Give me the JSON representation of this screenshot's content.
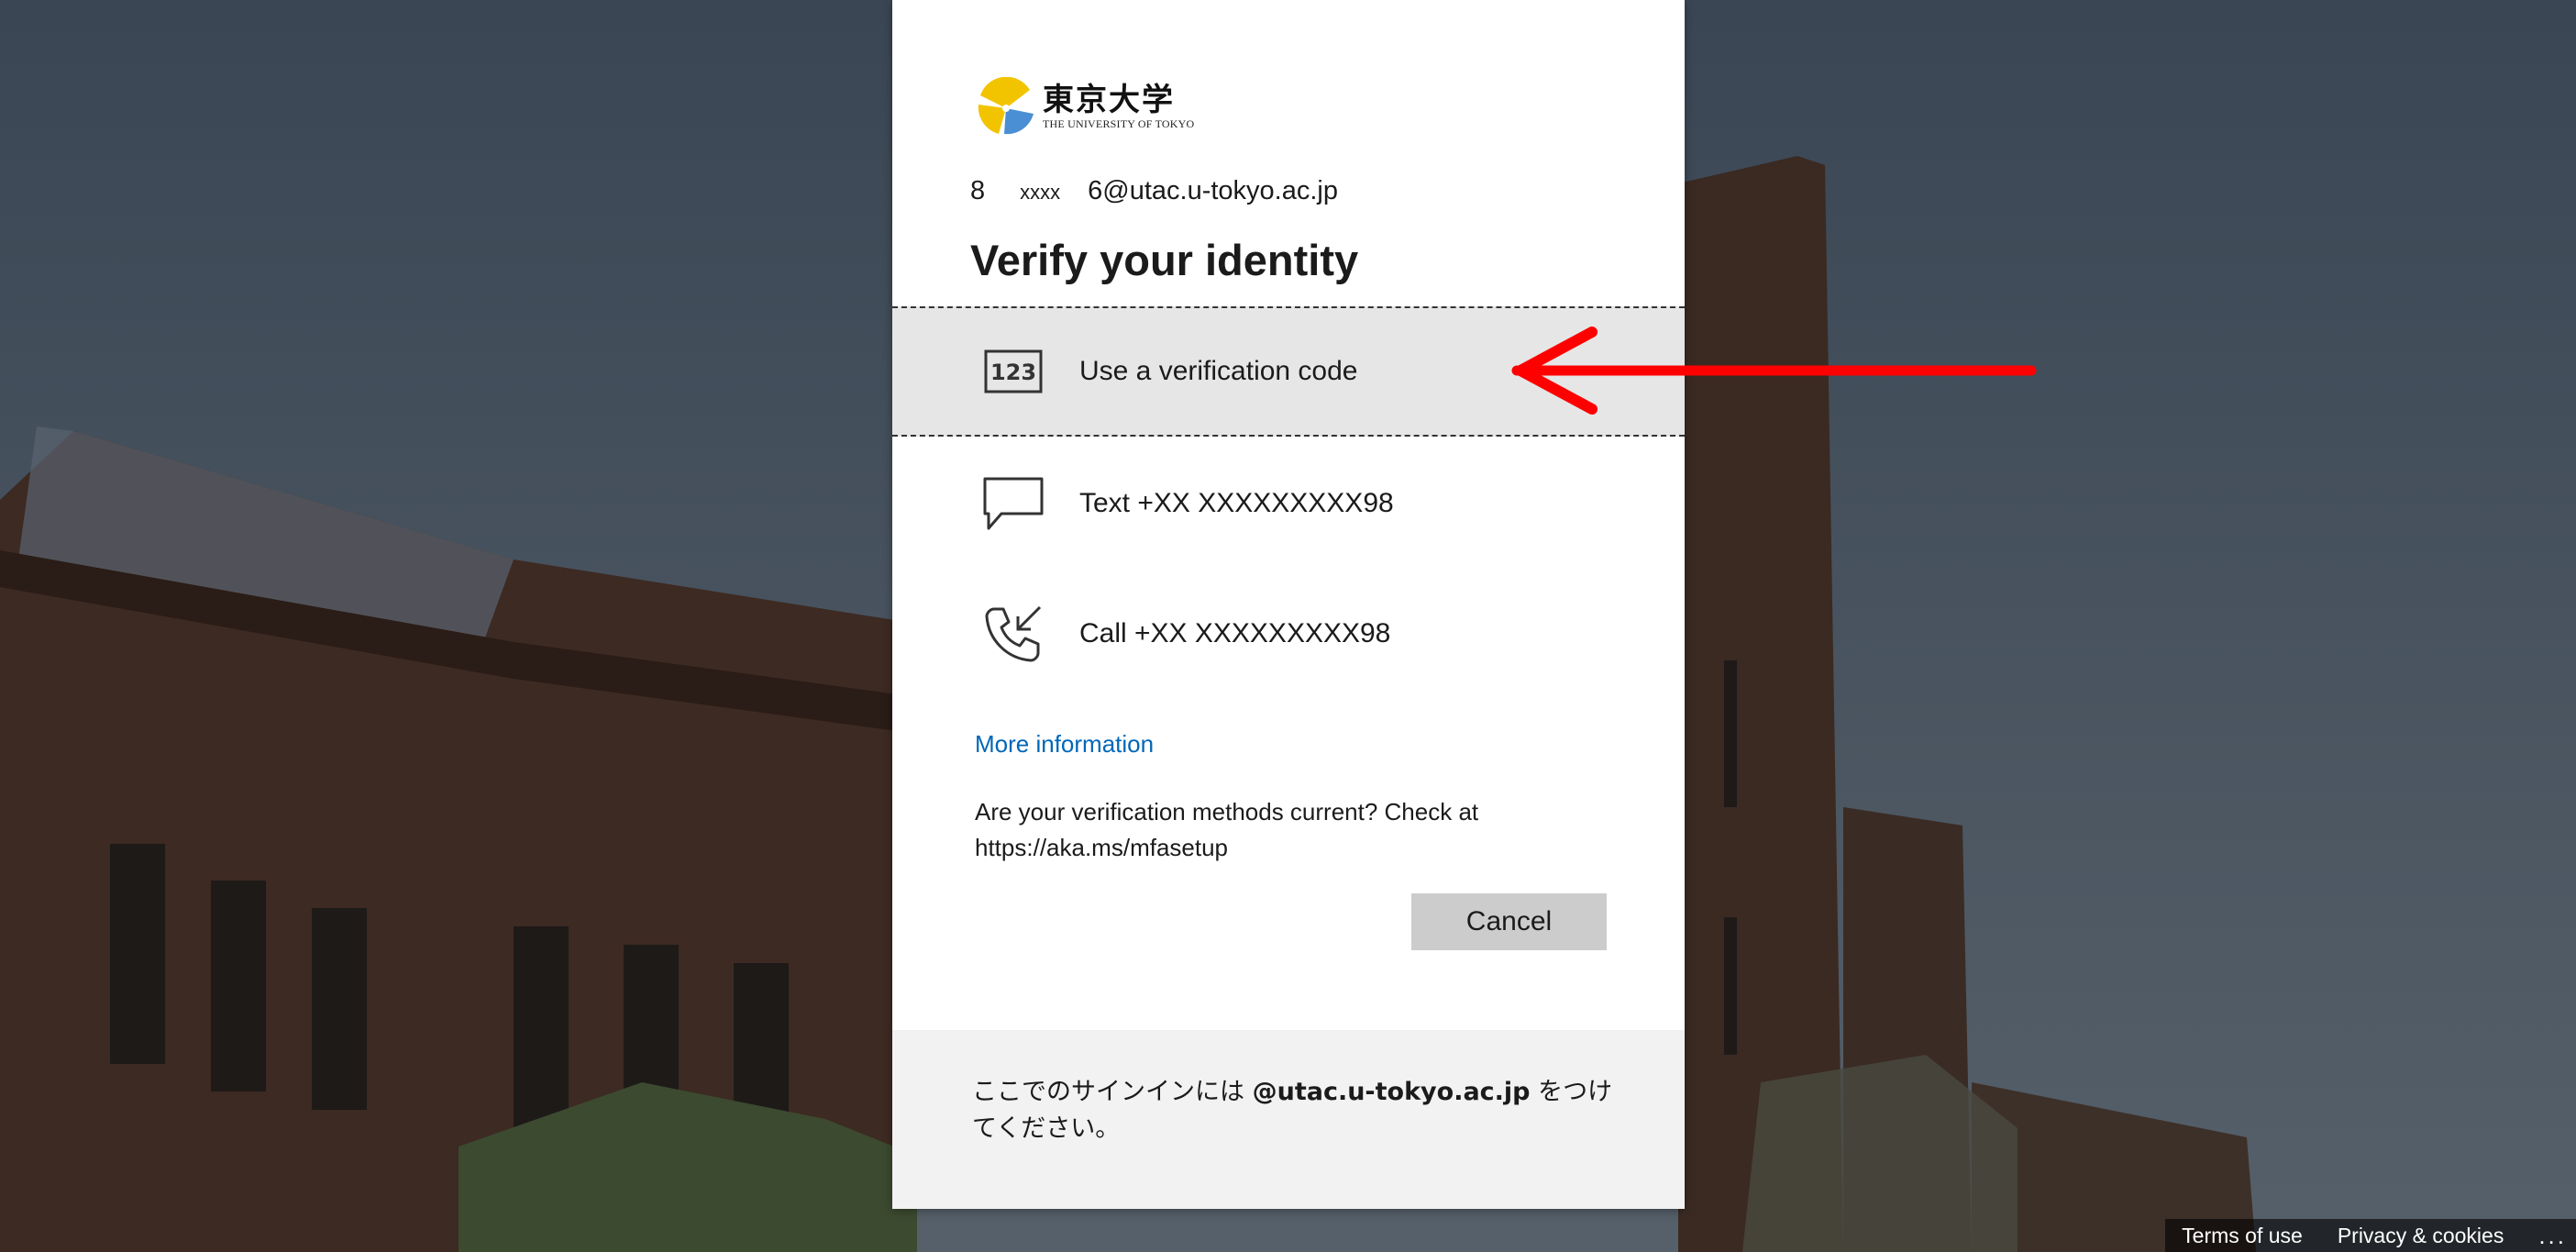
{
  "logo": {
    "japanese_name": "東京大学",
    "english_name": "THE UNIVERSITY OF TOKYO",
    "colors": {
      "yellow": "#f2c400",
      "blue": "#4a8fd4"
    }
  },
  "account": {
    "prefix": "8",
    "mask": "xxxx",
    "suffix": "6@utac.u-tokyo.ac.jp"
  },
  "title": "Verify your identity",
  "options": [
    {
      "icon": "verification-code-icon",
      "label": "Use a verification code",
      "selected": true
    },
    {
      "icon": "chat-bubble-icon",
      "label": "Text +XX XXXXXXXXX98",
      "selected": false
    },
    {
      "icon": "phone-call-icon",
      "label": "Call +XX XXXXXXXXX98",
      "selected": false
    }
  ],
  "more_info_link": "More information",
  "check_text": "Are your verification methods current? Check at https://aka.ms/mfasetup",
  "cancel_label": "Cancel",
  "footer_note": {
    "before": "ここでのサインインには ",
    "domain": "@utac.u-tokyo.ac.jp",
    "after": " をつけてください。"
  },
  "page_footer": {
    "terms": "Terms of use",
    "privacy": "Privacy & cookies",
    "more": "..."
  },
  "annotation": {
    "arrow_color": "#ff0000"
  },
  "colors": {
    "link": "#0067b8",
    "selected_bg": "#e6e6e6",
    "button_bg": "#cccccc",
    "footer_bg": "#f2f2f2"
  }
}
